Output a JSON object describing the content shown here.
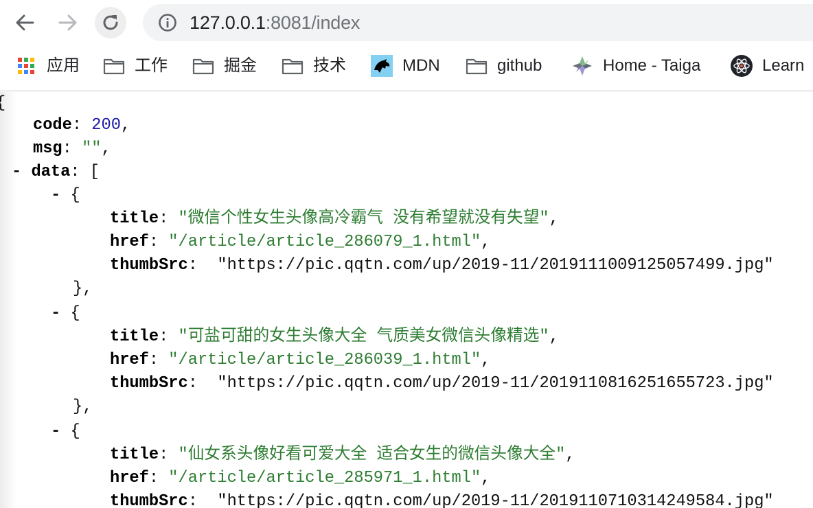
{
  "toolbar": {
    "url_host": "127.0.0.1",
    "url_path": ":8081/index"
  },
  "bookmarks": [
    {
      "label": "应用",
      "icon": "apps-grid-icon"
    },
    {
      "label": "工作",
      "icon": "folder-icon"
    },
    {
      "label": "掘金",
      "icon": "folder-icon"
    },
    {
      "label": "技术",
      "icon": "folder-icon"
    },
    {
      "label": "MDN",
      "icon": "mdn-dino-icon"
    },
    {
      "label": "github",
      "icon": "folder-icon"
    },
    {
      "label": "Home - Taiga",
      "icon": "taiga-icon"
    },
    {
      "label": "Learn",
      "icon": "react-atom-icon"
    }
  ],
  "json": {
    "open_brace": "{",
    "code_key": "code",
    "code_value": "200",
    "msg_key": "msg",
    "msg_value": "\"\"",
    "data_key": "data",
    "data_open": "[",
    "collapse_symbol": "-",
    "item_open": "{",
    "item_close": "},",
    "title_key": "title",
    "href_key": "href",
    "thumb_key": "thumbSrc",
    "items": [
      {
        "title": "\"微信个性女生头像高冷霸气 没有希望就没有失望\"",
        "href": "\"/article/article_286079_1.html\"",
        "thumbSrc": "\"https://pic.qqtn.com/up/2019-11/2019111009125057499.jpg\""
      },
      {
        "title": "\"可盐可甜的女生头像大全 气质美女微信头像精选\"",
        "href": "\"/article/article_286039_1.html\"",
        "thumbSrc": "\"https://pic.qqtn.com/up/2019-11/2019110816251655723.jpg\""
      },
      {
        "title": "\"仙女系头像好看可爱大全 适合女生的微信头像大全\"",
        "href": "\"/article/article_285971_1.html\"",
        "thumbSrc": "\"https://pic.qqtn.com/up/2019-11/2019110710314249584.jpg\""
      }
    ]
  }
}
